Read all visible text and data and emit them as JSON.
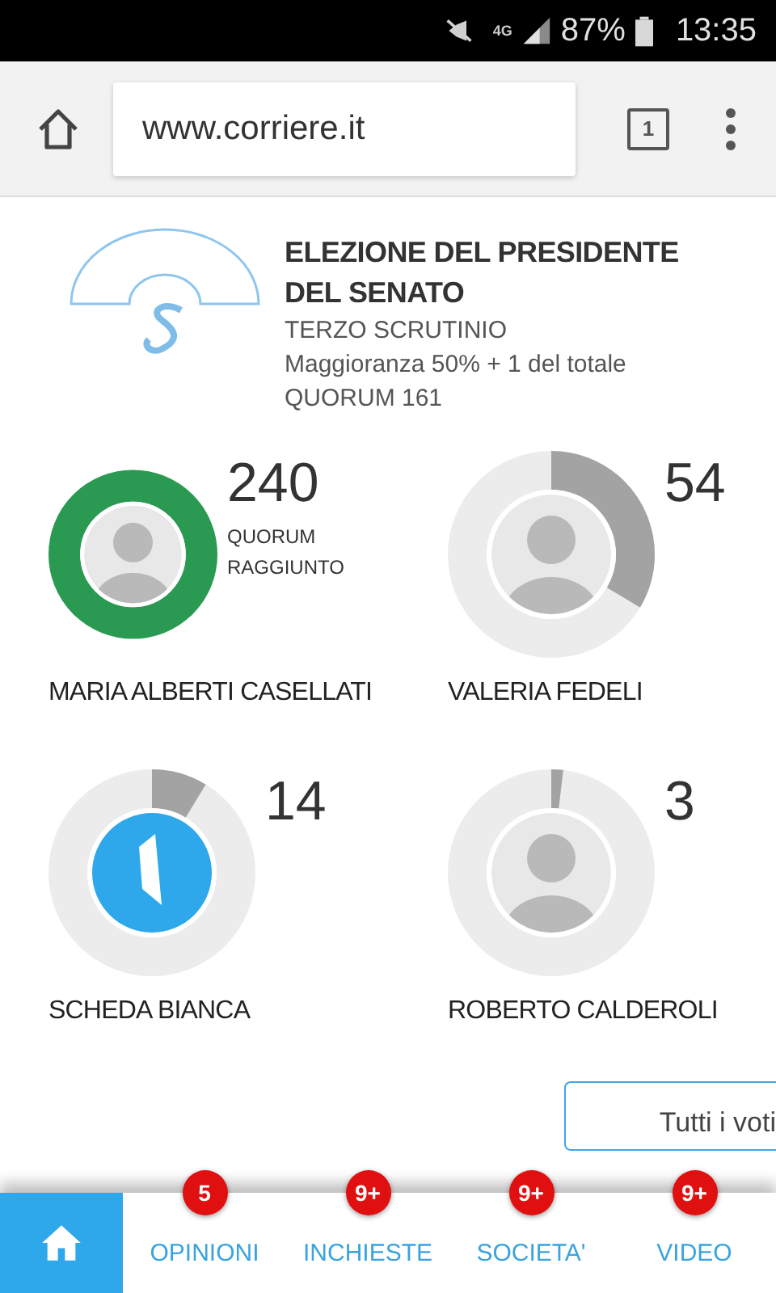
{
  "status_bar": {
    "network": "4G",
    "battery": "87%",
    "time": "13:35"
  },
  "browser": {
    "url": "www.corriere.it",
    "tab_count": "1"
  },
  "header": {
    "title": "ELEZIONE DEL PRESIDENTE DEL SENATO",
    "round": "TERZO SCRUTINIO",
    "majority": "Maggioranza 50% + 1 del totale",
    "quorum": "QUORUM 161"
  },
  "candidates": [
    {
      "name": "MARIA ALBERTI CASELLATI",
      "votes": "240",
      "note": "QUORUM RAGGIUNTO",
      "kind": "person",
      "reached": true
    },
    {
      "name": "VALERIA FEDELI",
      "votes": "54",
      "kind": "person",
      "reached": false
    },
    {
      "name": "SCHEDA BIANCA",
      "votes": "14",
      "kind": "blank",
      "reached": false
    },
    {
      "name": "ROBERTO CALDEROLI",
      "votes": "3",
      "kind": "person",
      "reached": false
    }
  ],
  "all_votes_button": "Tutti i voti",
  "nav": [
    {
      "kind": "home",
      "selected": true
    },
    {
      "label": "OPINIONI",
      "badge": "5",
      "selected": false
    },
    {
      "label": "INCHIESTE",
      "badge": "9+",
      "selected": false
    },
    {
      "label": "SOCIETA'",
      "badge": "9+",
      "selected": false
    },
    {
      "label": "VIDEO",
      "badge": "9+",
      "selected": false
    }
  ]
}
